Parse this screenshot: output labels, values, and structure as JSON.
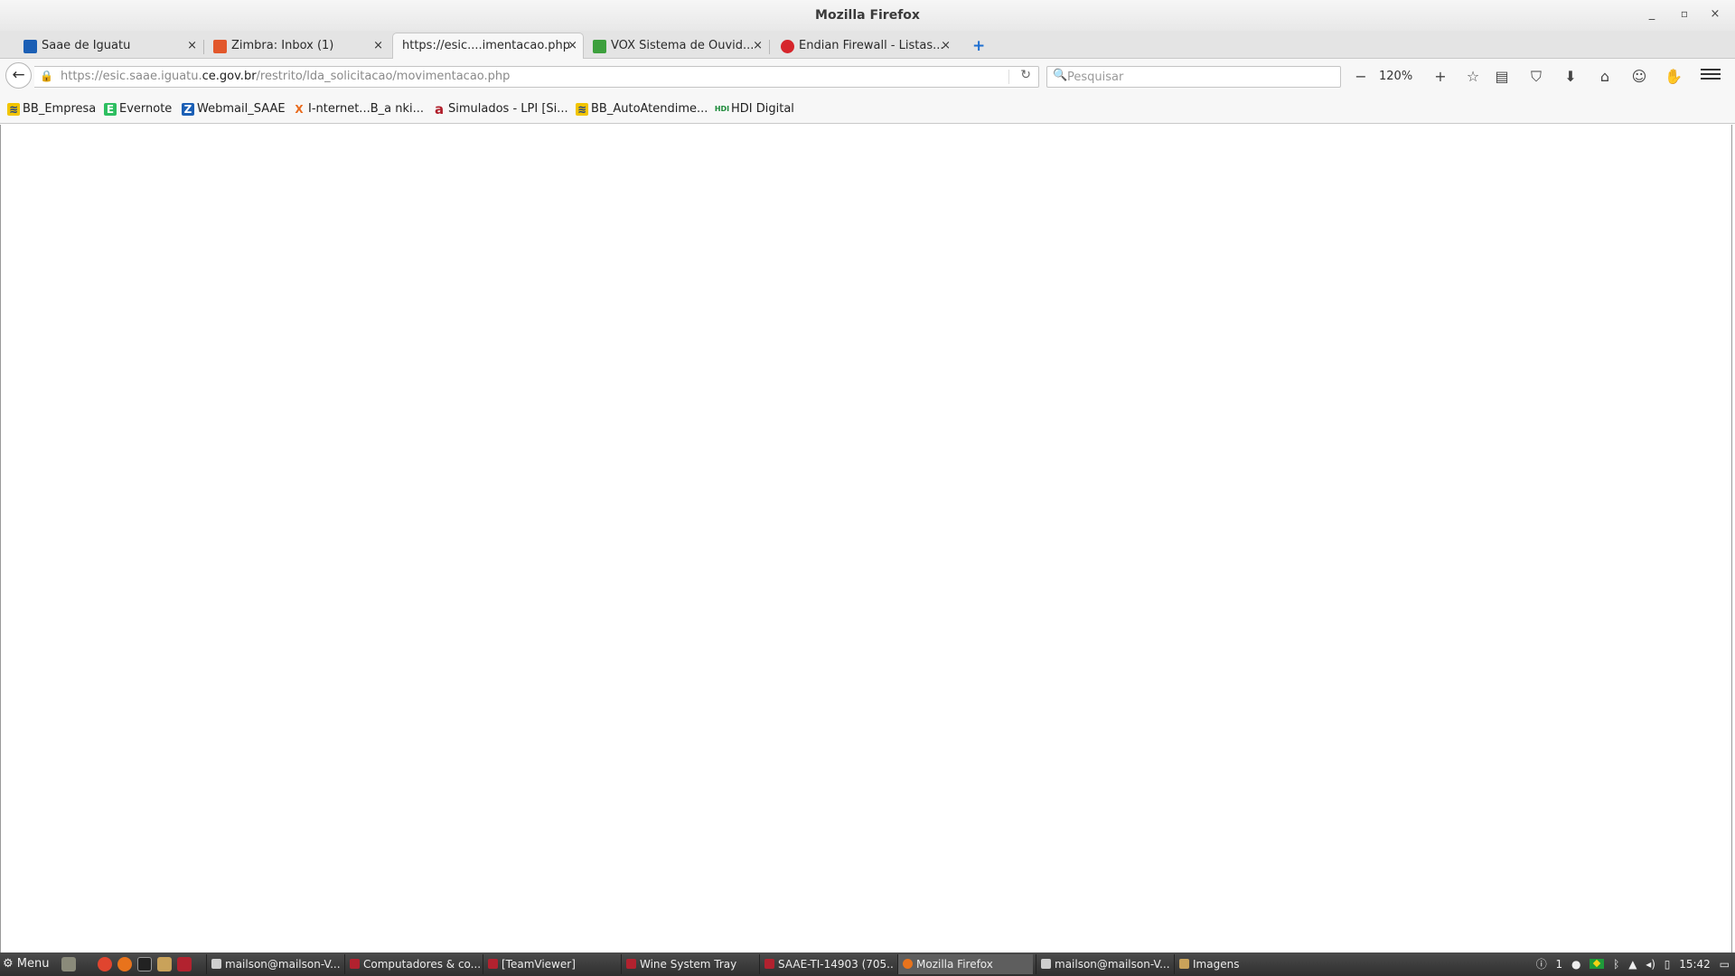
{
  "window": {
    "title": "Mozilla Firefox",
    "controls": {
      "minimize": "_",
      "maximize": "▫",
      "close": "×"
    }
  },
  "tabs": [
    {
      "label": "Saae de Iguatu",
      "favicon": "shield-icon",
      "favicon_color": "#1b5fb5",
      "close": "×"
    },
    {
      "label": "Zimbra: Inbox (1)",
      "favicon": "zimbra-icon",
      "favicon_color": "#e2572b",
      "close": "×"
    },
    {
      "label": "https://esic....imentacao.php",
      "favicon": "none",
      "active": true,
      "close": "×"
    },
    {
      "label": "VOX Sistema de Ouvid...",
      "favicon": "vox-icon",
      "favicon_color": "#3da03d",
      "close": "×"
    },
    {
      "label": "Endian Firewall - Listas...",
      "favicon": "endian-icon",
      "favicon_color": "#d6252b",
      "close": "×"
    }
  ],
  "new_tab": "+",
  "navbar": {
    "back": "←",
    "url_prefix": "https://esic.saae.iguatu.",
    "url_domain": "ce.gov.br",
    "url_path": "/restrito/lda_solicitacao/movimentacao.php",
    "reload": "↻",
    "search_placeholder": "Pesquisar",
    "search_icon": "🔍",
    "zoom_out": "−",
    "zoom_level": "120%",
    "zoom_in": "+",
    "toolbar_icons": [
      {
        "name": "bookmark-star-icon",
        "glyph": "☆"
      },
      {
        "name": "reader-list-icon",
        "glyph": "▤"
      },
      {
        "name": "pocket-icon",
        "glyph": "⛉"
      },
      {
        "name": "download-icon",
        "glyph": "⬇"
      },
      {
        "name": "home-icon",
        "glyph": "⌂"
      },
      {
        "name": "chat-icon",
        "glyph": "☺"
      },
      {
        "name": "hand-icon",
        "glyph": "✋"
      }
    ]
  },
  "bookmarks": [
    {
      "label": "BB_Empresa",
      "icon": "bb-icon",
      "glyph": "≋",
      "color": "#f2c500"
    },
    {
      "label": "Evernote",
      "icon": "evernote-icon",
      "glyph": "E",
      "color": "#2dbe60"
    },
    {
      "label": "Webmail_SAAE",
      "icon": "zimbra-icon",
      "glyph": "Z",
      "color": "#1b5fb5"
    },
    {
      "label": "I-nternet...B_a nki...",
      "icon": "xing-icon",
      "glyph": "X",
      "color": "#e96b1e"
    },
    {
      "label": "Simulados - LPI [Si...",
      "icon": "simulados-icon",
      "glyph": "a",
      "color": "#b01e2a"
    },
    {
      "label": "BB_AutoAtendime...",
      "icon": "bb-icon",
      "glyph": "≋",
      "color": "#f2c500"
    },
    {
      "label": "HDI Digital",
      "icon": "hdi-icon",
      "glyph": "HDI",
      "color": "#1d8a3a"
    }
  ],
  "taskbar": {
    "menu_label": "Menu",
    "windows": [
      {
        "label": "mailson@mailson-V...",
        "color": "#cfcfcf"
      },
      {
        "label": "Computadores & co...",
        "color": "#b2222f"
      },
      {
        "label": "[TeamViewer]",
        "color": "#b2222f"
      },
      {
        "label": "Wine System Tray",
        "color": "#b2222f"
      },
      {
        "label": "SAAE-TI-14903 (705...",
        "color": "#b2222f"
      },
      {
        "label": "Mozilla Firefox",
        "color": "#e8731c",
        "active": true
      },
      {
        "label": "mailson@mailson-V...",
        "color": "#cfcfcf"
      },
      {
        "label": "Imagens",
        "color": "#c9a25a"
      }
    ],
    "tray": {
      "info": "ⓘ",
      "workspace": "1",
      "clock": "15:42"
    }
  }
}
